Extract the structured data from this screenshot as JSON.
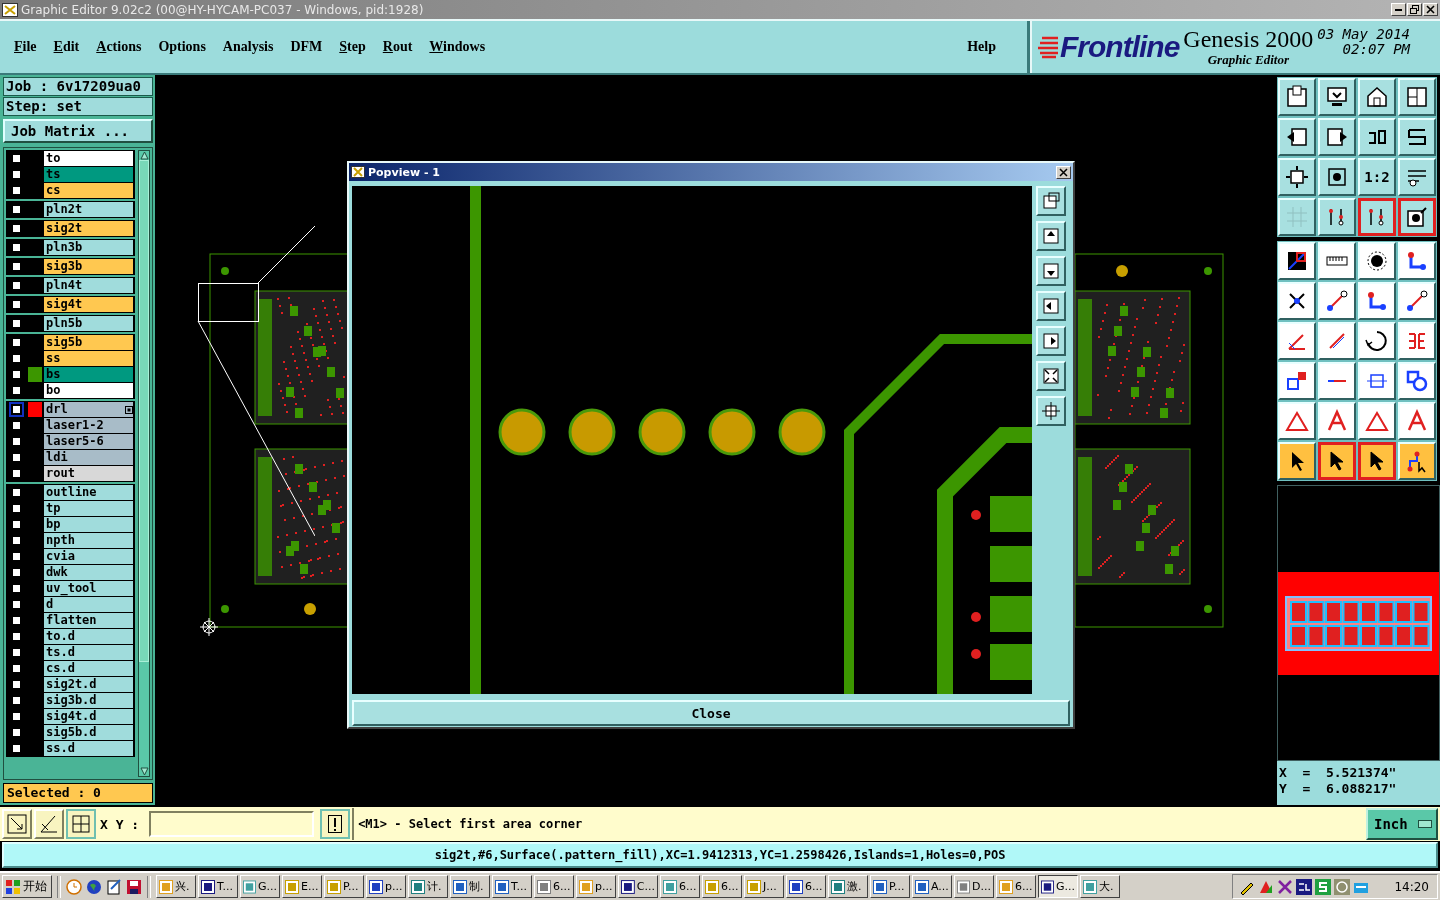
{
  "window": {
    "title": "Graphic Editor 9.02c2 (00@HY-HYCAM-PC037 - Windows, pid:1928)"
  },
  "menu": [
    {
      "label": "File",
      "underlined": true
    },
    {
      "label": "Edit",
      "underlined": true
    },
    {
      "label": "Actions",
      "underlined": true
    },
    {
      "label": "Options",
      "underlined": false
    },
    {
      "label": "Analysis",
      "underlined": false
    },
    {
      "label": "DFM",
      "underlined": false
    },
    {
      "label": "Step",
      "underlined": true
    },
    {
      "label": "Rout",
      "underlined": true
    },
    {
      "label": "Windows",
      "underlined": true
    },
    {
      "label": "Help",
      "underlined": false
    }
  ],
  "logo": {
    "brand": "Frontline",
    "product": "Genesis 2000",
    "subtitle": "Graphic Editor",
    "date": "03 May 2014",
    "time": "02:07 PM"
  },
  "job": {
    "job": "Job  :  6v17209ua0",
    "step": "Step:  set",
    "matrix_button": "Job Matrix ...",
    "selected_count": "Selected : 0"
  },
  "layer_groups": [
    {
      "layers": [
        {
          "name": "to",
          "color": "#ffffff",
          "selected": false
        },
        {
          "name": "ts",
          "color": "#009980",
          "selected": false
        },
        {
          "name": "cs",
          "color": "#ffc850",
          "selected": false
        }
      ]
    },
    {
      "layers": [
        {
          "name": "pln2t",
          "color": "#a0dcdc",
          "selected": false
        }
      ]
    },
    {
      "layers": [
        {
          "name": "sig2t",
          "color": "#ffc850",
          "selected": false
        }
      ]
    },
    {
      "layers": [
        {
          "name": "pln3b",
          "color": "#a0dcdc",
          "selected": false
        }
      ]
    },
    {
      "layers": [
        {
          "name": "sig3b",
          "color": "#ffc850",
          "selected": false
        }
      ]
    },
    {
      "layers": [
        {
          "name": "pln4t",
          "color": "#a0dcdc",
          "selected": false
        }
      ]
    },
    {
      "layers": [
        {
          "name": "sig4t",
          "color": "#ffc850",
          "selected": false
        }
      ]
    },
    {
      "layers": [
        {
          "name": "pln5b",
          "color": "#a0dcdc",
          "selected": false
        }
      ]
    },
    {
      "layers": [
        {
          "name": "sig5b",
          "color": "#ffc850",
          "selected": false
        },
        {
          "name": "ss",
          "color": "#ffc850",
          "selected": false
        },
        {
          "name": "bs",
          "color": "#009980",
          "selected": false,
          "swatch": {
            "color": "#3c9600"
          }
        },
        {
          "name": "bo",
          "color": "#ffffff",
          "selected": false
        }
      ]
    },
    {
      "layers": [
        {
          "name": "drl",
          "color": "#a8bcc8",
          "selected": false,
          "work_layer": true,
          "swatch": {
            "color": "#ff0000"
          }
        },
        {
          "name": "laser1-2",
          "color": "#a8bcc8",
          "selected": false
        },
        {
          "name": "laser5-6",
          "color": "#a8bcc8",
          "selected": false
        },
        {
          "name": "ldi",
          "color": "#a8bcc8",
          "selected": false
        },
        {
          "name": "rout",
          "color": "#d8d8d8",
          "selected": false
        }
      ]
    },
    {
      "layers": [
        {
          "name": "outline",
          "color": "#a0dcdc",
          "selected": false
        },
        {
          "name": "tp",
          "color": "#a0dcdc",
          "selected": false
        },
        {
          "name": "bp",
          "color": "#a0dcdc",
          "selected": false
        },
        {
          "name": "npth",
          "color": "#a0dcdc",
          "selected": false
        },
        {
          "name": "cvia",
          "color": "#a0dcdc",
          "selected": false
        },
        {
          "name": "dwk",
          "color": "#a0dcdc",
          "selected": false
        },
        {
          "name": "uv_tool",
          "color": "#a0dcdc",
          "selected": false
        },
        {
          "name": "d",
          "color": "#a0dcdc",
          "selected": false
        },
        {
          "name": "flatten",
          "color": "#a0dcdc",
          "selected": false
        },
        {
          "name": "to.d",
          "color": "#a0dcdc",
          "selected": false
        },
        {
          "name": "ts.d",
          "color": "#a0dcdc",
          "selected": false
        },
        {
          "name": "cs.d",
          "color": "#a0dcdc",
          "selected": false
        },
        {
          "name": "sig2t.d",
          "color": "#a0dcdc",
          "selected": false
        },
        {
          "name": "sig3b.d",
          "color": "#a0dcdc",
          "selected": false
        },
        {
          "name": "sig4t.d",
          "color": "#a0dcdc",
          "selected": false
        },
        {
          "name": "sig5b.d",
          "color": "#a0dcdc",
          "selected": false
        },
        {
          "name": "ss.d",
          "color": "#a0dcdc",
          "selected": false
        }
      ]
    }
  ],
  "popview": {
    "title": "Popview - 1",
    "close_button": "Close"
  },
  "tool_buttons": [
    {
      "selected": false
    },
    {
      "selected": false
    },
    {
      "selected": false
    },
    {
      "selected": false
    },
    {
      "selected": false
    },
    {
      "selected": false
    },
    {
      "selected": false
    },
    {
      "selected": false
    },
    {
      "selected": false
    },
    {
      "selected": false
    },
    {
      "selected": false,
      "label": "1:2"
    },
    {
      "selected": false
    },
    {
      "selected": false
    },
    {
      "selected": false
    },
    {
      "selected": true
    },
    {
      "selected": true
    },
    {
      "selected": false
    },
    {
      "selected": false
    },
    {
      "selected": false
    },
    {
      "selected": false
    },
    {
      "selected": false
    },
    {
      "selected": false
    },
    {
      "selected": false
    },
    {
      "selected": false
    },
    {
      "selected": false
    },
    {
      "selected": false
    },
    {
      "selected": false
    },
    {
      "selected": false
    },
    {
      "selected": false
    },
    {
      "selected": false
    },
    {
      "selected": false
    },
    {
      "selected": false
    },
    {
      "selected": false
    },
    {
      "selected": false
    },
    {
      "selected": false
    },
    {
      "selected": false
    },
    {
      "selected": false
    },
    {
      "selected": true
    },
    {
      "selected": true
    },
    {
      "selected": false
    }
  ],
  "coordinates": {
    "x": "X  =  5.521374\"",
    "y": "Y  =  6.088217\""
  },
  "command_bar": {
    "xy_label": "X Y :",
    "prompt": "<M1> - Select first area corner",
    "units": "Inch"
  },
  "status_bar": "sig2t,#6,Surface(.pattern_fill),XC=1.9412313,YC=1.2598426,Islands=1,Holes=0,POS",
  "taskbar": {
    "start": "开始",
    "tasks": [
      {
        "label": "兴.",
        "selected": false
      },
      {
        "label": "T...",
        "selected": false
      },
      {
        "label": "G...",
        "selected": false
      },
      {
        "label": "E...",
        "selected": false
      },
      {
        "label": "P...",
        "selected": false
      },
      {
        "label": "p...",
        "selected": false
      },
      {
        "label": "计.",
        "selected": false
      },
      {
        "label": "制.",
        "selected": false
      },
      {
        "label": "T...",
        "selected": false
      },
      {
        "label": "6...",
        "selected": false
      },
      {
        "label": "p...",
        "selected": false
      },
      {
        "label": "C...",
        "selected": false
      },
      {
        "label": "6...",
        "selected": false
      },
      {
        "label": "6...",
        "selected": false
      },
      {
        "label": "J...",
        "selected": false
      },
      {
        "label": "6...",
        "selected": false
      },
      {
        "label": "激.",
        "selected": false
      },
      {
        "label": "P...",
        "selected": false
      },
      {
        "label": "A...",
        "selected": false
      },
      {
        "label": "D...",
        "selected": false
      },
      {
        "label": "6...",
        "selected": false
      },
      {
        "label": "G...",
        "selected": true
      },
      {
        "label": "大.",
        "selected": false
      }
    ],
    "clock": "14:20"
  }
}
